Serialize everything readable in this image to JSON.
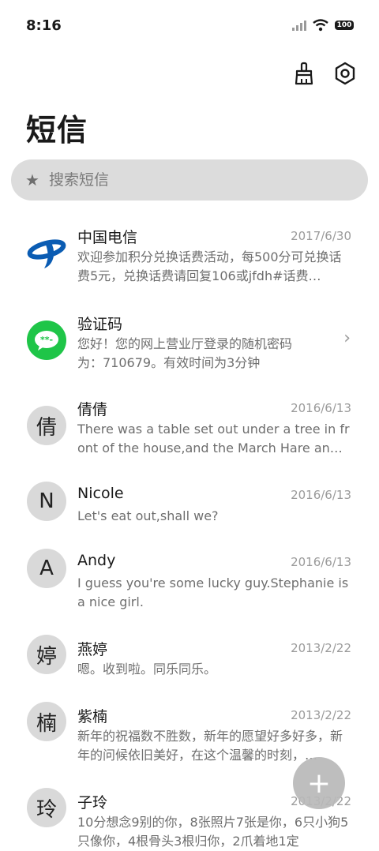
{
  "status": {
    "time": "8:16",
    "battery": "100"
  },
  "header": {
    "title": "短信"
  },
  "search": {
    "placeholder": "搜索短信"
  },
  "messages": [
    {
      "name": "中国电信",
      "date": "2017/6/30",
      "preview": "欢迎参加积分兑换话费活动，每500分可兑换话费5元，兑换话费请回复106或jfdh#话费…",
      "avatar": "china-telecom-logo"
    },
    {
      "name": "验证码",
      "date": "",
      "preview": "您好！您的网上营业厅登录的随机密码为：710679。有效时间为3分钟",
      "avatar": "sms-bubble"
    },
    {
      "name": "倩倩",
      "date": "2016/6/13",
      "preview": "There was a table set out under a tree in front of the house,and the March Hare an…",
      "avatar_letter": "倩"
    },
    {
      "name": "Nicole",
      "date": "2016/6/13",
      "preview": "Let's eat out,shall we?",
      "avatar_letter": "N"
    },
    {
      "name": "Andy",
      "date": "2016/6/13",
      "preview": "I guess you're some lucky guy.Stephanie is a nice girl.",
      "avatar_letter": "A"
    },
    {
      "name": "燕婷",
      "date": "2013/2/22",
      "preview": "嗯。收到啦。同乐同乐。",
      "avatar_letter": "婷"
    },
    {
      "name": "紫楠",
      "date": "2013/2/22",
      "preview": "新年的祝福数不胜数，新年的愿望好多好多，新年的问候依旧美好，在这个温馨的时刻，…",
      "avatar_letter": "楠"
    },
    {
      "name": "子玲",
      "date": "2013/2/22",
      "preview": "10分想念9别的你，8张照片7张是你，6只小狗5只像你，4根骨头3根归你，2爪着地1定",
      "avatar_letter": "玲"
    }
  ],
  "fab": {
    "label": "+"
  },
  "colors": {
    "accent_green": "#1fc548",
    "telecom_blue": "#0a5cb3"
  }
}
